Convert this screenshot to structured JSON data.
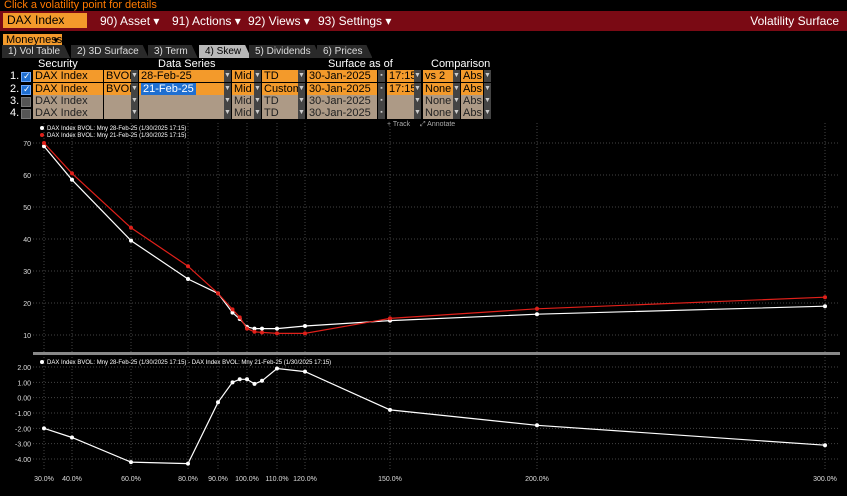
{
  "hint": "Click a volatility point for details",
  "security_pill": "DAX Index",
  "menus": [
    "90) Asset ▾",
    "91) Actions ▾",
    "92) Views ▾",
    "93) Settings ▾"
  ],
  "app_title": "Volatility Surface",
  "moneyness": "Moneyness",
  "tabs": [
    "1) Vol Table",
    "2) 3D Surface",
    "3) Term",
    "4) Skew",
    "5) Dividends",
    "6) Prices"
  ],
  "active_tab": "4) Skew",
  "headers": {
    "security": "Security",
    "data_series": "Data Series",
    "surface_as_of": "Surface as of",
    "comparison": "Comparison"
  },
  "rows": [
    {
      "num": "1.",
      "checked": true,
      "security": "DAX Index",
      "source": "BVOL",
      "series": "28-Feb-25",
      "side": "Mid",
      "model": "TD",
      "date": "30-Jan-2025",
      "time": "17:15",
      "comp": "vs 2",
      "abs": "Abs"
    },
    {
      "num": "2.",
      "checked": true,
      "security": "DAX Index",
      "source": "BVOL",
      "series": "21-Feb-25",
      "side": "Mid",
      "model": "Custom",
      "date": "30-Jan-2025",
      "time": "17:15",
      "comp": "None",
      "abs": "Abs"
    },
    {
      "num": "3.",
      "checked": false,
      "security": "DAX Index",
      "source": "",
      "series": "",
      "side": "Mid",
      "model": "TD",
      "date": "30-Jan-2025",
      "time": "",
      "comp": "None",
      "abs": "Abs"
    },
    {
      "num": "4.",
      "checked": false,
      "security": "DAX Index",
      "source": "",
      "series": "",
      "side": "Mid",
      "model": "TD",
      "date": "30-Jan-2025",
      "time": "",
      "comp": "None",
      "abs": "Abs"
    }
  ],
  "track_label": "Track",
  "annotate_label": "Annotate",
  "colors": {
    "white_series": "#ffffff",
    "red_series": "#e0201a",
    "orange": "#f39a2b",
    "menubar": "#7a0a14"
  },
  "chart_data": [
    {
      "type": "line",
      "x": [
        30,
        40,
        60,
        80,
        90,
        95,
        97.5,
        100,
        102.5,
        105,
        110,
        120,
        150,
        200,
        300
      ],
      "series": [
        {
          "name": "DAX Index BVOL: Mny 28-Feb-25 (1/30/2025 17:15)",
          "color": "#ffffff",
          "values": [
            69,
            58.5,
            39.5,
            27.5,
            23,
            17,
            15,
            12.5,
            12,
            12,
            12,
            12.8,
            14.5,
            16.5,
            19
          ]
        },
        {
          "name": "DAX Index BVOL: Mny 21-Feb-25 (1/30/2025 17:15)",
          "color": "#e0201a",
          "values": [
            70,
            60.5,
            43.5,
            31.5,
            23,
            18,
            15.5,
            12,
            11,
            10.8,
            10.5,
            10.5,
            15.2,
            18.2,
            21.8
          ]
        }
      ],
      "y_ticks": [
        10,
        20,
        30,
        40,
        50,
        60,
        70
      ],
      "ylim": [
        5,
        73
      ],
      "grid": true,
      "legend": "top-left"
    },
    {
      "type": "line",
      "x": [
        30,
        40,
        60,
        80,
        90,
        95,
        97.5,
        100,
        102.5,
        105,
        110,
        120,
        150,
        200,
        300
      ],
      "series": [
        {
          "name": "DAX Index BVOL: Mny 28-Feb-25 (1/30/2025 17:15) - DAX Index BVOL: Mny 21-Feb-25 (1/30/2025 17:15)",
          "color": "#ffffff",
          "values": [
            -2.0,
            -2.6,
            -4.2,
            -4.3,
            -0.3,
            1.0,
            1.2,
            1.2,
            0.9,
            1.1,
            1.9,
            1.7,
            -0.8,
            -1.8,
            -3.1
          ]
        }
      ],
      "y_ticks": [
        -4.0,
        -3.0,
        -2.0,
        -1.0,
        0.0,
        1.0,
        2.0
      ],
      "ylim": [
        -4.7,
        2.4
      ],
      "grid": true,
      "legend": "top-left"
    }
  ],
  "x_tick_labels": [
    "30.0%",
    "40.0%",
    "60.0%",
    "80.0%",
    "90.0%",
    "100.0%",
    "110.0%",
    "120.0%",
    "150.0%",
    "200.0%",
    "300.0%"
  ],
  "x_tick_values": [
    30,
    40,
    60,
    80,
    90,
    100,
    110,
    120,
    150,
    200,
    300
  ]
}
